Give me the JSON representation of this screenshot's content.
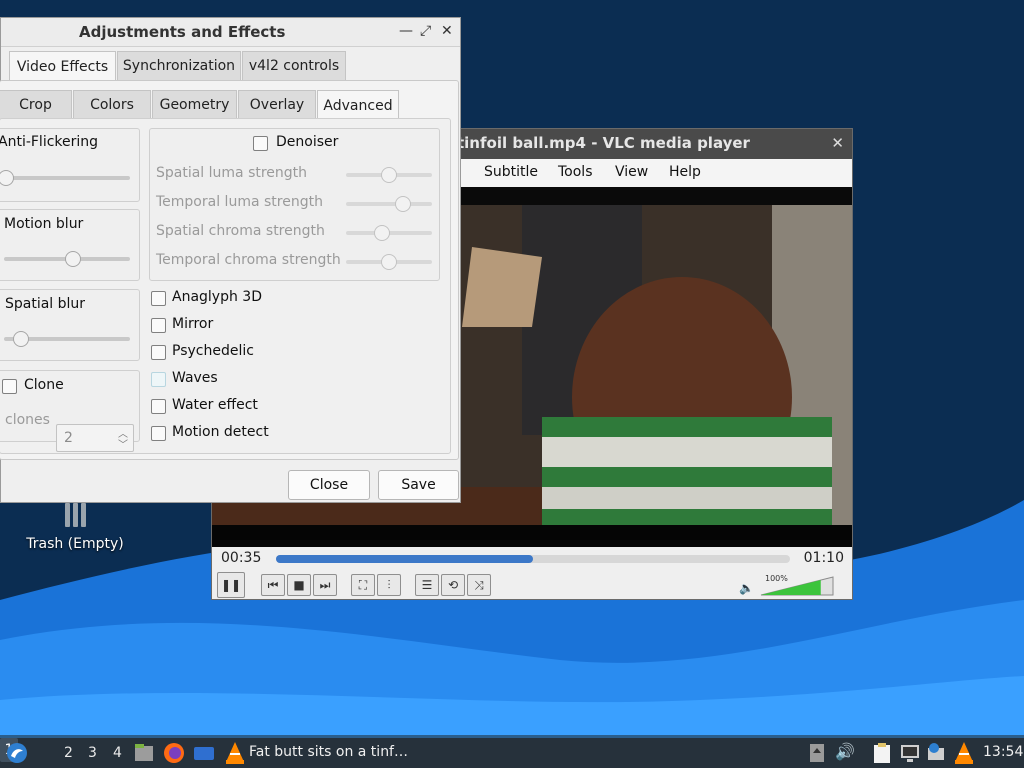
{
  "desktop": {
    "trash_label": "Trash (Empty)"
  },
  "vlc": {
    "title": "tinfoil ball.mp4 - VLC media player",
    "menu": [
      "Subtitle",
      "Tools",
      "View",
      "Help"
    ],
    "time_current": "00:35",
    "time_total": "01:10",
    "progress_fraction": 0.5,
    "volume_label": "100%",
    "volume_fraction": 0.83,
    "accent_color": "#3c78c8",
    "volume_color": "#3cc43c"
  },
  "adjustments": {
    "title": "Adjustments and Effects",
    "top_tabs": [
      "Video Effects",
      "Synchronization",
      "v4l2 controls"
    ],
    "active_top_tab": "Video Effects",
    "sub_tabs": [
      "Crop",
      "Colors",
      "Geometry",
      "Overlay",
      "Advanced"
    ],
    "active_sub_tab": "Advanced",
    "left_sections": {
      "anti_flickering": "Anti-Flickering",
      "motion_blur": "Motion blur",
      "spatial_blur": "Spatial blur",
      "clone": "Clone",
      "clones_label": "clones",
      "clones_value": "2"
    },
    "denoiser": {
      "label": "Denoiser",
      "checked": false,
      "params": [
        {
          "label": "Spatial luma strength",
          "value": 0.5
        },
        {
          "label": "Temporal luma strength",
          "value": 0.7
        },
        {
          "label": "Spatial chroma strength",
          "value": 0.4
        },
        {
          "label": "Temporal chroma strength",
          "value": 0.5
        }
      ]
    },
    "effects": [
      {
        "label": "Anaglyph 3D",
        "checked": false
      },
      {
        "label": "Mirror",
        "checked": false
      },
      {
        "label": "Psychedelic",
        "checked": false
      },
      {
        "label": "Waves",
        "checked": false
      },
      {
        "label": "Water effect",
        "checked": false
      },
      {
        "label": "Motion detect",
        "checked": false
      }
    ],
    "close_label": "Close",
    "save_label": "Save"
  },
  "taskbar": {
    "workspaces": [
      "1",
      "2",
      "3",
      "4"
    ],
    "active_workspace": "1",
    "task_title": "Fat butt sits on a tinf…",
    "clock": "13:54"
  }
}
